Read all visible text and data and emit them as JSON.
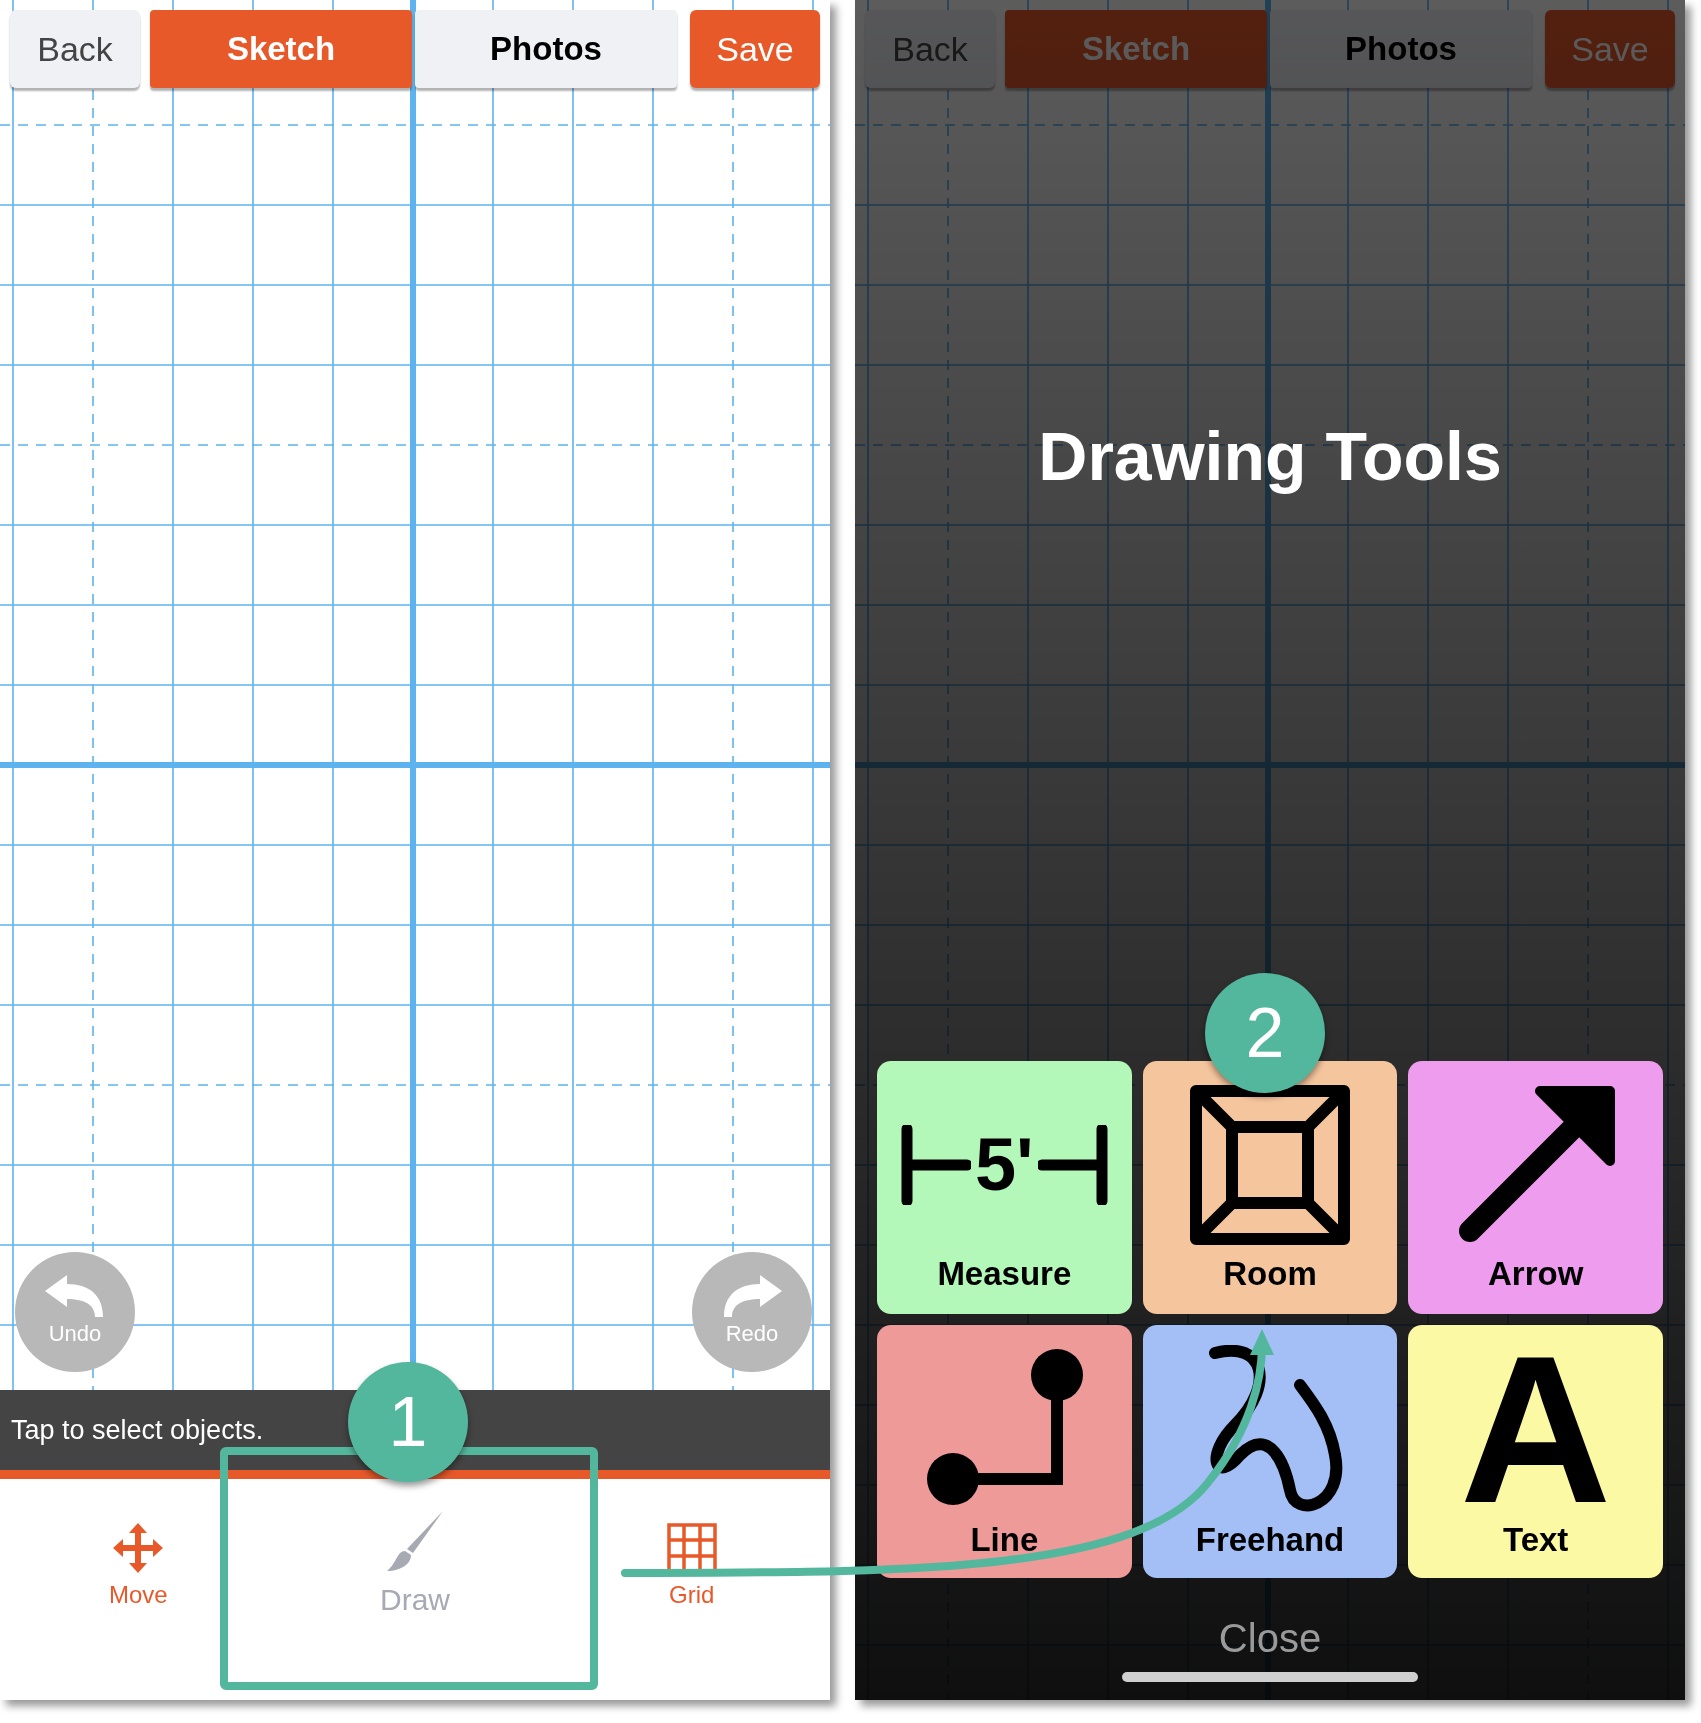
{
  "left_screen": {
    "top_bar": {
      "back": "Back",
      "tabs": [
        {
          "label": "Sketch",
          "selected": true
        },
        {
          "label": "Photos",
          "selected": false
        }
      ],
      "save": "Save"
    },
    "undo": "Undo",
    "redo": "Redo",
    "hint": "Tap to select objects.",
    "toolbar": [
      {
        "label": "Move",
        "kind": "move",
        "selected": false
      },
      {
        "label": "Draw",
        "kind": "draw",
        "selected": true
      },
      {
        "label": "Grid",
        "kind": "grid",
        "selected": false
      }
    ]
  },
  "right_screen": {
    "top_bar": {
      "back": "Back",
      "tabs": [
        {
          "label": "Sketch",
          "selected": true
        },
        {
          "label": "Photos",
          "selected": false
        }
      ],
      "save": "Save"
    },
    "title": "Drawing Tools",
    "tools": [
      {
        "label": "Measure",
        "kind": "measure",
        "color": "#b3f7b9",
        "glyph": "5'"
      },
      {
        "label": "Room",
        "kind": "room",
        "color": "#f5c59d"
      },
      {
        "label": "Arrow",
        "kind": "arrow",
        "color": "#ee9cee"
      },
      {
        "label": "Line",
        "kind": "line",
        "color": "#ee9a98"
      },
      {
        "label": "Freehand",
        "kind": "freehand",
        "color": "#a3bff5"
      },
      {
        "label": "Text",
        "kind": "text",
        "color": "#fbf9a3",
        "glyph": "A"
      }
    ],
    "close": "Close"
  },
  "callouts": [
    {
      "number": "1"
    },
    {
      "number": "2"
    }
  ]
}
